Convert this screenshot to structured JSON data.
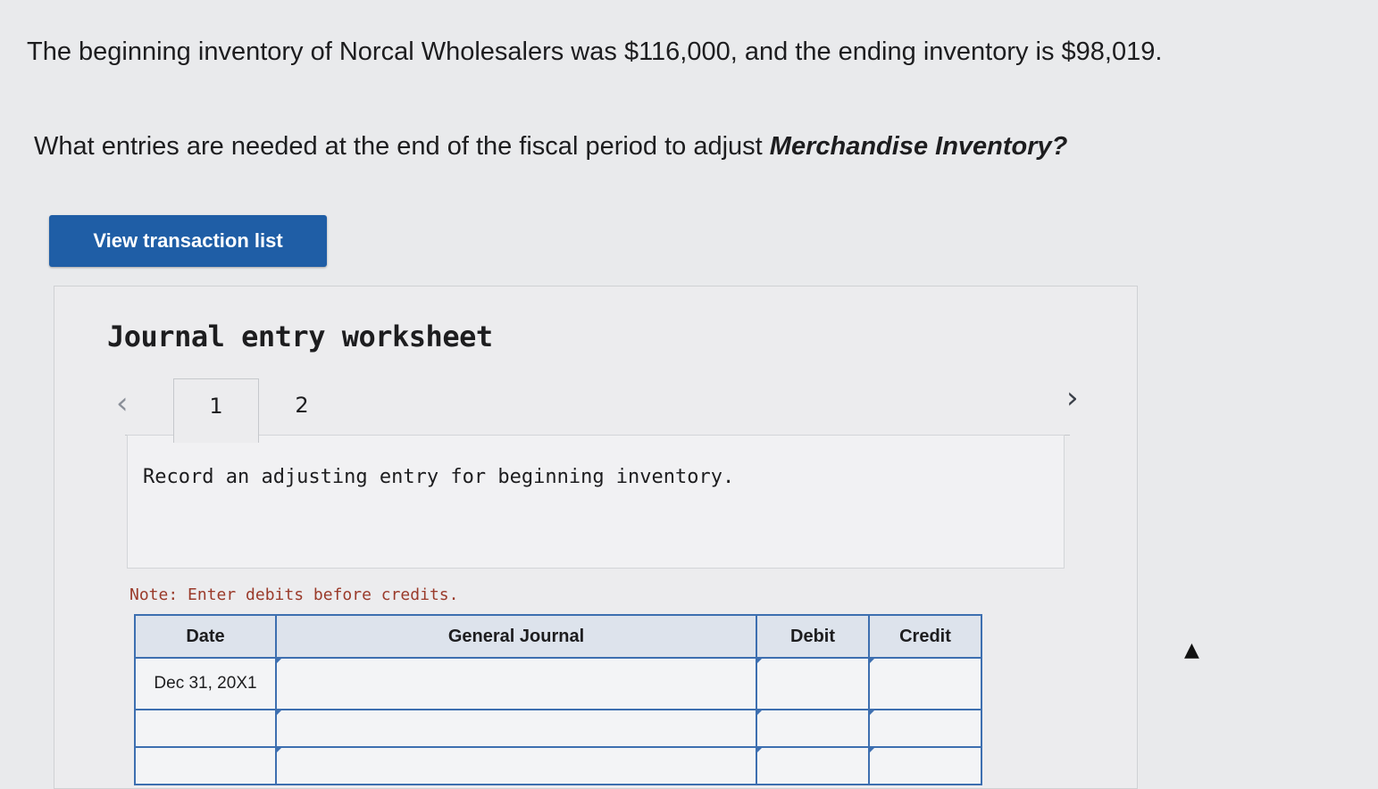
{
  "question": {
    "line1": "The beginning inventory of Norcal Wholesalers was $116,000, and the ending inventory is $98,019.",
    "line2_prefix": "What entries are needed at the end of the fiscal period to adjust ",
    "line2_emphasis": "Merchandise Inventory?"
  },
  "view_button": {
    "label": "View transaction list"
  },
  "worksheet": {
    "title": "Journal entry worksheet",
    "prev_icon": "‹",
    "next_icon": "›",
    "tabs": [
      {
        "label": "1"
      },
      {
        "label": "2"
      }
    ],
    "prompt": "Record an adjusting entry for beginning inventory.",
    "note": "Note: Enter debits before credits."
  },
  "journal": {
    "headers": {
      "date": "Date",
      "account": "General Journal",
      "debit": "Debit",
      "credit": "Credit"
    },
    "rows": [
      {
        "date": "Dec 31, 20X1",
        "account": "",
        "debit": "",
        "credit": ""
      },
      {
        "date": "",
        "account": "",
        "debit": "",
        "credit": ""
      },
      {
        "date": "",
        "account": "",
        "debit": "",
        "credit": ""
      }
    ]
  },
  "cursor_icon": "mouse-pointer-icon"
}
